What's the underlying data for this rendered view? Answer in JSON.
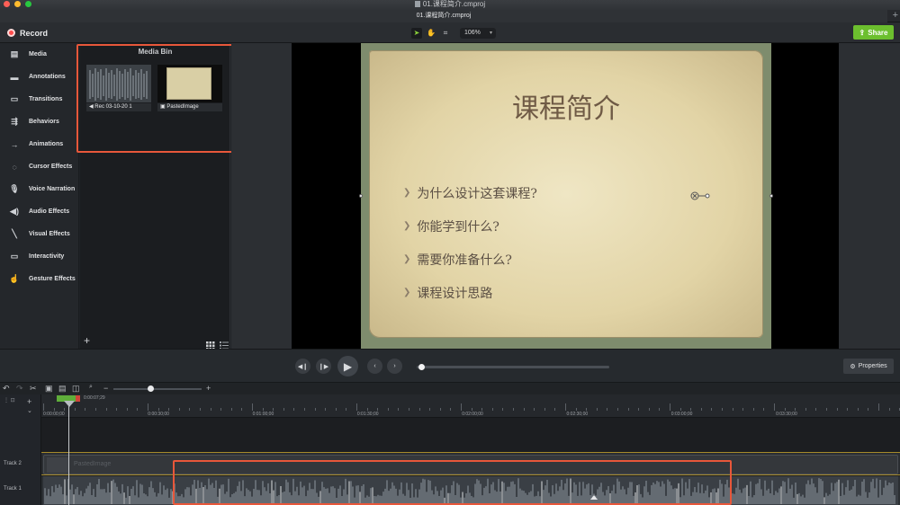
{
  "window": {
    "title": "01.课程简介.cmproj",
    "tab_label": "01.课程简介.cmproj",
    "tab_add": "+"
  },
  "toolbar": {
    "record_label": "Record",
    "zoom_value": "106%",
    "share_label": "Share",
    "share_color": "#6cbf2e"
  },
  "sidebar": {
    "items": [
      {
        "label": "Media",
        "icon": "film-icon"
      },
      {
        "label": "Annotations",
        "icon": "callout-icon"
      },
      {
        "label": "Transitions",
        "icon": "transition-icon"
      },
      {
        "label": "Behaviors",
        "icon": "behavior-icon"
      },
      {
        "label": "Animations",
        "icon": "animation-icon"
      },
      {
        "label": "Cursor Effects",
        "icon": "cursor-icon"
      },
      {
        "label": "Voice Narration",
        "icon": "microphone-icon"
      },
      {
        "label": "Audio Effects",
        "icon": "speaker-icon"
      },
      {
        "label": "Visual Effects",
        "icon": "wand-icon"
      },
      {
        "label": "Interactivity",
        "icon": "interactivity-icon"
      },
      {
        "label": "Gesture Effects",
        "icon": "hand-icon"
      }
    ]
  },
  "media_bin": {
    "title": "Media Bin",
    "items": [
      {
        "label": "Rec 03-10-20 1",
        "kind": "audio"
      },
      {
        "label": "PastedImage",
        "kind": "image"
      }
    ],
    "add": "+"
  },
  "slide": {
    "title": "课程简介",
    "bullets": [
      "为什么设计这套课程?",
      "你能学到什么?",
      "需要你准备什么?",
      "课程设计思路"
    ],
    "bullet_marker": "❯"
  },
  "transport": {
    "properties_label": "Properties",
    "playhead_progress": 0.01
  },
  "timeline": {
    "playhead_time": "0:00:07;29",
    "ruler_labels": [
      "0:00:00;00",
      "0:00:30;00",
      "0:01:00;00",
      "0:01:30;00",
      "0:02:00;00",
      "0:02:30;00",
      "0:03:00;00",
      "0:03:30;00"
    ],
    "tracks": [
      {
        "name": "Track 2",
        "clip_label": "PastedImage"
      },
      {
        "name": "Track 1"
      }
    ]
  },
  "colors": {
    "highlight": "#e8573a",
    "accent": "#8bd13b"
  }
}
